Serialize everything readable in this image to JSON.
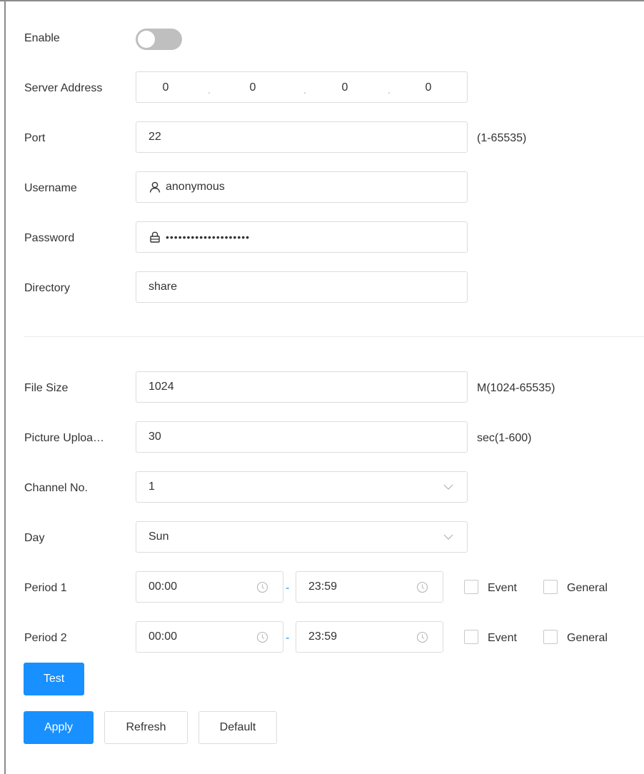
{
  "colors": {
    "accent": "#1890ff",
    "toggle_off": "#bfbfbf",
    "border": "#dcdcdc"
  },
  "enable": {
    "label": "Enable",
    "state": "off"
  },
  "server_address": {
    "label": "Server Address",
    "octets": [
      "0",
      "0",
      "0",
      "0"
    ],
    "separator": "."
  },
  "port": {
    "label": "Port",
    "value": "22",
    "hint": "(1-65535)"
  },
  "username": {
    "label": "Username",
    "value": "anonymous",
    "icon": "user-icon"
  },
  "password": {
    "label": "Password",
    "value": "••••••••••••••••••••",
    "icon": "lock-icon"
  },
  "directory": {
    "label": "Directory",
    "value": "share"
  },
  "file_size": {
    "label": "File Size",
    "value": "1024",
    "hint": "M(1024-65535)"
  },
  "picture_upload": {
    "label": "Picture Uploa…",
    "value": "30",
    "hint": "sec(1-600)"
  },
  "channel": {
    "label": "Channel No.",
    "value": "1",
    "icon": "chevron-down-icon"
  },
  "day": {
    "label": "Day",
    "value": "Sun",
    "icon": "chevron-down-icon"
  },
  "periods": [
    {
      "label": "Period 1",
      "start": "00:00",
      "end": "23:59",
      "event_label": "Event",
      "general_label": "General"
    },
    {
      "label": "Period 2",
      "start": "00:00",
      "end": "23:59",
      "event_label": "Event",
      "general_label": "General"
    }
  ],
  "range_separator": "-",
  "buttons": {
    "test": "Test",
    "apply": "Apply",
    "refresh": "Refresh",
    "default": "Default"
  }
}
